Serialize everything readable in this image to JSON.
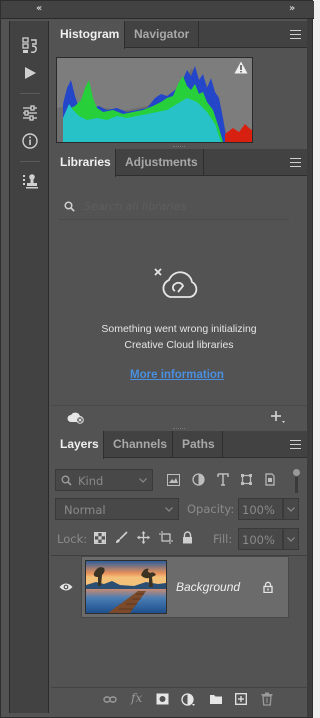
{
  "histogram_panel": {
    "tabs": [
      {
        "label": "Histogram",
        "active": true
      },
      {
        "label": "Navigator",
        "active": false
      }
    ],
    "warning_icon": "warning-triangle-icon"
  },
  "libraries_panel": {
    "tabs": [
      {
        "label": "Libraries",
        "active": true
      },
      {
        "label": "Adjustments",
        "active": false
      }
    ],
    "search_placeholder": "Search all libraries",
    "error_line1": "Something went wrong initializing",
    "error_line2": "Creative Cloud libraries",
    "more_info_link": "More information",
    "link_color": "#4a8fe0"
  },
  "layers_panel": {
    "tabs": [
      {
        "label": "Layers",
        "active": true
      },
      {
        "label": "Channels",
        "active": false
      },
      {
        "label": "Paths",
        "active": false
      }
    ],
    "filter_kind": "Kind",
    "blend_mode": "Normal",
    "opacity_label": "Opacity:",
    "opacity_value": "100%",
    "lock_label": "Lock:",
    "fill_label": "Fill:",
    "fill_value": "100%",
    "layers": [
      {
        "name": "Background",
        "visible": true,
        "locked": true
      }
    ]
  },
  "toolbar_icons": [
    "history-icon",
    "play-action-icon",
    "adjust-sliders-icon",
    "info-icon",
    "clone-source-icon"
  ]
}
